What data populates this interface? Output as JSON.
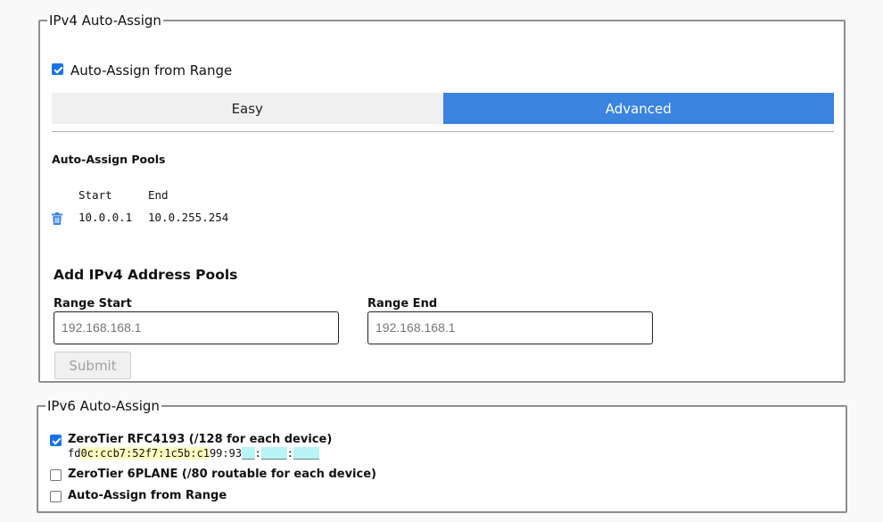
{
  "ipv4": {
    "legend": "IPv4 Auto-Assign",
    "auto_assign_checkbox": {
      "label": "Auto-Assign from Range",
      "checked": true
    },
    "tabs": [
      {
        "label": "Easy",
        "active": false
      },
      {
        "label": "Advanced",
        "active": true
      }
    ],
    "pools": {
      "title": "Auto-Assign Pools",
      "columns": [
        "Start",
        "End"
      ],
      "rows": [
        {
          "start": "10.0.0.1",
          "end": "10.0.255.254"
        }
      ]
    },
    "add_pool": {
      "title": "Add IPv4 Address Pools",
      "range_start_label": "Range Start",
      "range_start_placeholder": "192.168.168.1",
      "range_end_label": "Range End",
      "range_end_placeholder": "192.168.168.1",
      "submit_label": "Submit"
    }
  },
  "ipv6": {
    "legend": "IPv6 Auto-Assign",
    "options": [
      {
        "label": "ZeroTier RFC4193 (/128 for each device)",
        "checked": true
      },
      {
        "label": "ZeroTier 6PLANE (/80 routable for each device)",
        "checked": false
      },
      {
        "label": "Auto-Assign from Range",
        "checked": false
      }
    ],
    "rfc4193_address": {
      "prefix": "fd",
      "part1": "0c:ccb7:52f7:1c5b:c1",
      "part2": "99:93",
      "part3": "__",
      "sep1": ":",
      "part4": "____",
      "sep2": ":",
      "part5": "____"
    }
  },
  "colors": {
    "accent": "#3a84e0",
    "checkbox_accent": "#1a73e8",
    "border": "#8f8f8f",
    "highlight_yellow": "#ffffc0",
    "highlight_cyan": "#b8f4f4"
  }
}
